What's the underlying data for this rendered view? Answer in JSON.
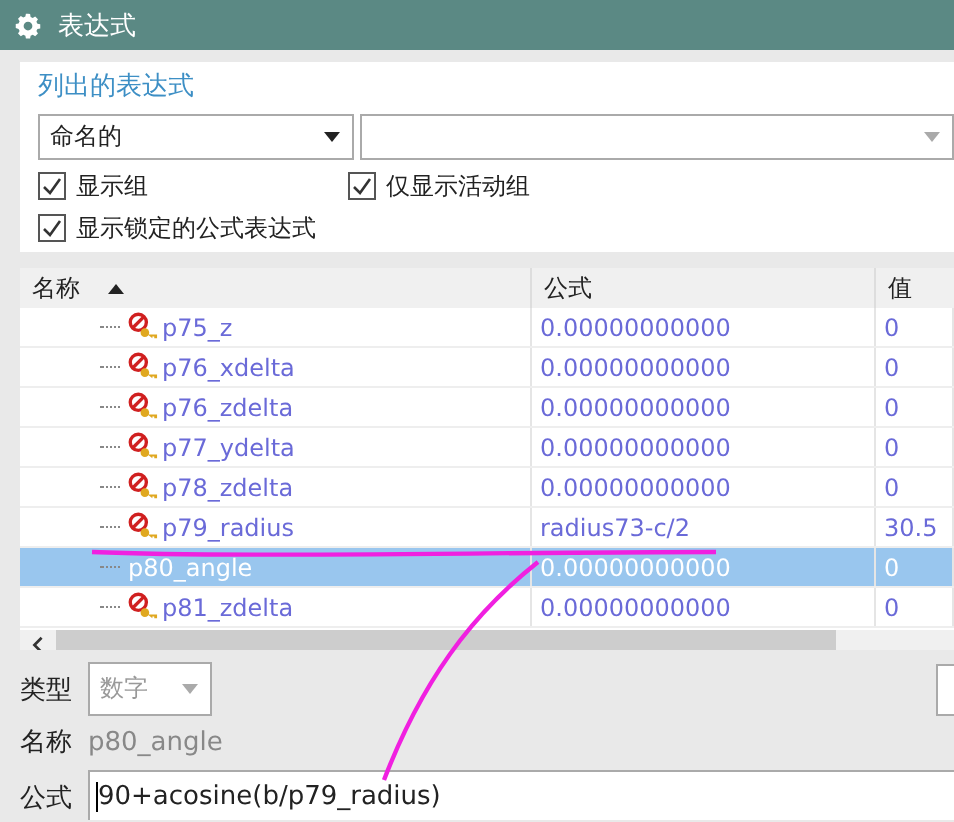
{
  "window": {
    "title": "表达式"
  },
  "listed": {
    "title": "列出的表达式",
    "filter": "命名的",
    "options": [
      {
        "label": "显示组",
        "checked": true
      },
      {
        "label": "仅显示活动组",
        "checked": true
      },
      {
        "label": "显示锁定的公式表达式",
        "checked": true
      }
    ]
  },
  "table": {
    "columns": [
      {
        "label": "名称",
        "sorted": true
      },
      {
        "label": "公式",
        "sorted": false
      },
      {
        "label": "值",
        "sorted": false
      }
    ],
    "rows": [
      {
        "name": "p75_z",
        "formula": "0.00000000000",
        "value": "0",
        "locked": true,
        "selected": false
      },
      {
        "name": "p76_xdelta",
        "formula": "0.00000000000",
        "value": "0",
        "locked": true,
        "selected": false
      },
      {
        "name": "p76_zdelta",
        "formula": "0.00000000000",
        "value": "0",
        "locked": true,
        "selected": false
      },
      {
        "name": "p77_ydelta",
        "formula": "0.00000000000",
        "value": "0",
        "locked": true,
        "selected": false
      },
      {
        "name": "p78_zdelta",
        "formula": "0.00000000000",
        "value": "0",
        "locked": true,
        "selected": false
      },
      {
        "name": "p79_radius",
        "formula": "radius73-c/2",
        "value": "30.5",
        "locked": true,
        "selected": false
      },
      {
        "name": "p80_angle",
        "formula": "0.00000000000",
        "value": "0",
        "locked": false,
        "selected": true
      },
      {
        "name": "p81_zdelta",
        "formula": "0.00000000000",
        "value": "0",
        "locked": true,
        "selected": false
      }
    ]
  },
  "details": {
    "type_label": "类型",
    "type_value": "数字",
    "type_disabled": true,
    "name_label": "名称",
    "name_value": "p80_angle",
    "formula_label": "公式",
    "formula_value": "90+acosine(b/p79_radius)"
  }
}
